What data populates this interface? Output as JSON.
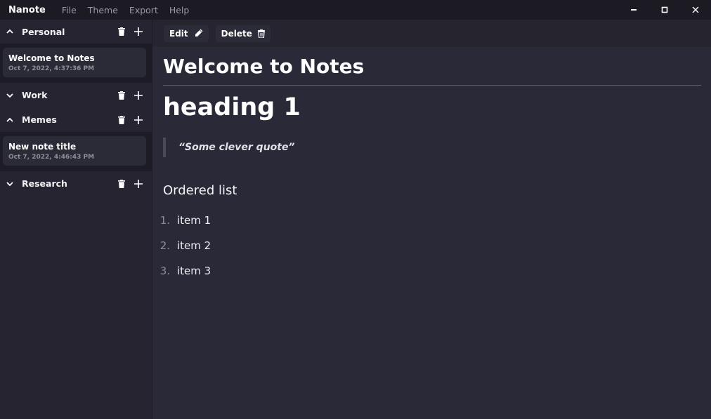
{
  "app": {
    "name": "Nanote",
    "menu": [
      "File",
      "Theme",
      "Export",
      "Help"
    ]
  },
  "window_controls": [
    "minimize-icon",
    "maximize-icon",
    "close-icon"
  ],
  "sidebar": {
    "groups": [
      {
        "name": "Personal",
        "expanded": true,
        "notes": [
          {
            "title": "Welcome to Notes",
            "date": "Oct 7, 2022, 4:37:36 PM"
          }
        ]
      },
      {
        "name": "Work",
        "expanded": false,
        "notes": []
      },
      {
        "name": "Memes",
        "expanded": true,
        "notes": [
          {
            "title": "New note title",
            "date": "Oct 7, 2022, 4:46:43 PM"
          }
        ]
      },
      {
        "name": "Research",
        "expanded": false,
        "notes": []
      }
    ]
  },
  "toolbar": {
    "edit_label": "Edit",
    "delete_label": "Delete"
  },
  "note": {
    "title": "Welcome to Notes",
    "heading1": "heading 1",
    "quote": "“Some clever quote”",
    "subheading": "Ordered list",
    "list": [
      {
        "num": "1.",
        "text": "item 1"
      },
      {
        "num": "2.",
        "text": "item 2"
      },
      {
        "num": "3.",
        "text": "item 3"
      }
    ]
  },
  "colors": {
    "background": "#2a2937",
    "sidebar": "#252430",
    "titlebar": "#1c1b24",
    "card": "#2b2a37"
  }
}
